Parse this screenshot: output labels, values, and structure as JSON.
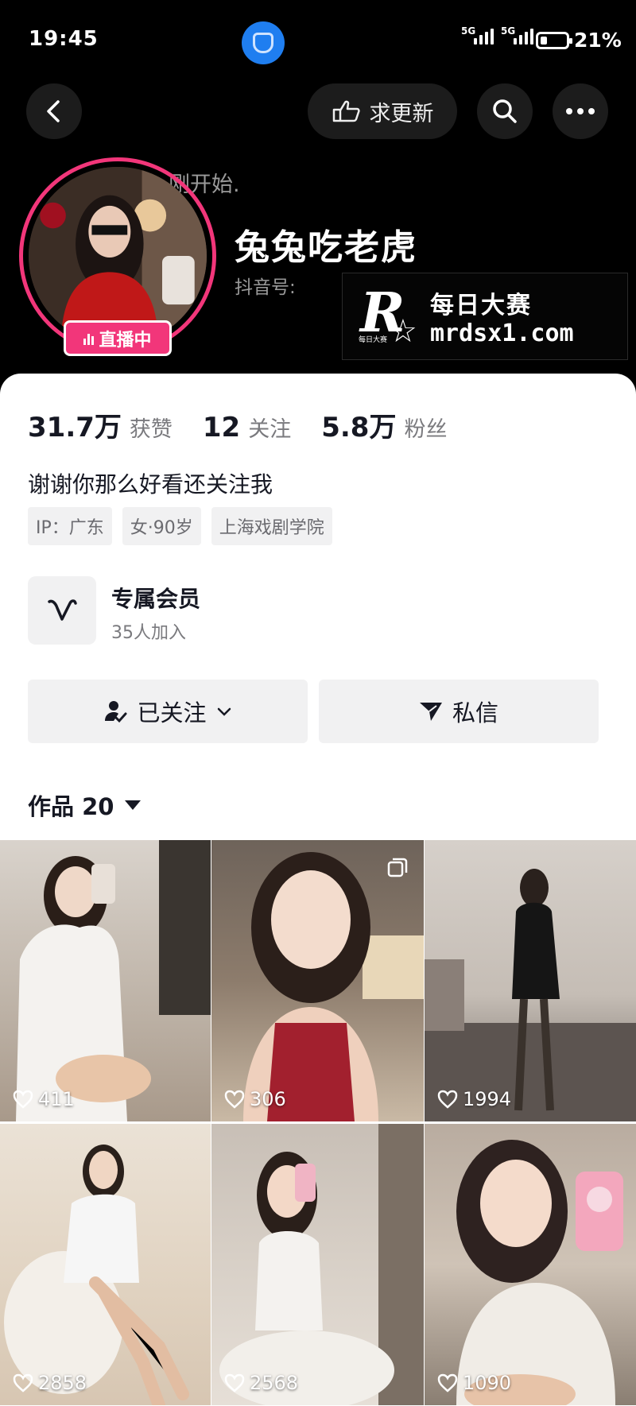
{
  "status_bar": {
    "time": "19:45",
    "sim1": "5G",
    "sim2": "5G",
    "battery": "21%"
  },
  "nav": {
    "update_label": "求更新"
  },
  "profile": {
    "faded_text": "刚开始.",
    "name": "兔兔吃老虎",
    "douyin_id_label": "抖音号:",
    "live_label": "直播中"
  },
  "watermark": {
    "logo": "R",
    "small": "每日大赛",
    "title": "每日大赛",
    "url": "mrdsx1.com"
  },
  "stats": [
    {
      "num": "31.7万",
      "label": "获赞"
    },
    {
      "num": "12",
      "label": "关注"
    },
    {
      "num": "5.8万",
      "label": "粉丝"
    }
  ],
  "bio": "谢谢你那么好看还关注我",
  "tags": [
    "IP：广东",
    "女·90岁",
    "上海戏剧学院"
  ],
  "membership": {
    "title": "专属会员",
    "subtitle": "35人加入"
  },
  "buttons": {
    "follow": "已关注",
    "message": "私信"
  },
  "works": {
    "label": "作品 20"
  },
  "videos": [
    {
      "likes": "411"
    },
    {
      "likes": "306",
      "multi": true
    },
    {
      "likes": "1994"
    },
    {
      "likes": "2858"
    },
    {
      "likes": "2568"
    },
    {
      "likes": "1090"
    }
  ],
  "colors": {
    "accent": "#f2367a",
    "app_icon": "#1f7ef0",
    "sheet_bg": "#ffffff",
    "button_bg": "#f1f1f2"
  },
  "icons": [
    "back-icon",
    "hand-point-icon",
    "search-icon",
    "more-icon",
    "live-bars-icon",
    "v-member-icon",
    "person-check-icon",
    "chevron-down-icon",
    "paper-plane-icon",
    "caret-down-icon",
    "heart-icon",
    "multi-photo-icon"
  ]
}
